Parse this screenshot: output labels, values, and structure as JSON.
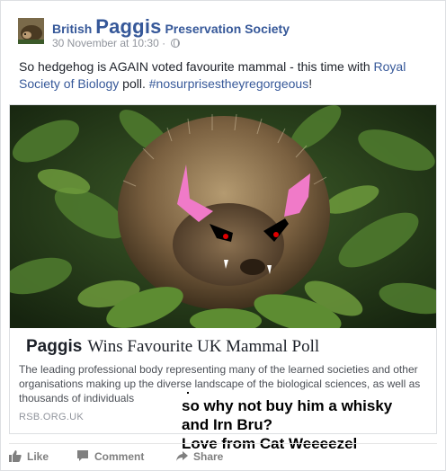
{
  "post": {
    "page_name_prefix": "British",
    "page_name_main": "Paggis",
    "page_name_suffix": "Preservation Society",
    "timestamp": "30 November at 10:30",
    "separator": "·",
    "text_before_link": "So hedgehog is AGAIN voted favourite mammal - this time with ",
    "link_text": "Royal Society of Biology",
    "text_middle": " poll. ",
    "hashtag": "#nosurprisestheyregorgeous",
    "text_end": "!"
  },
  "link_preview": {
    "title_prefix": "Paggis",
    "title": "Wins Favourite UK Mammal Poll",
    "description": "The leading professional body representing many of the learned societies and other organisations making up the diverse landscape of the biological sciences, as well as thousands of individuals",
    "domain": "RSB.ORG.UK"
  },
  "overlay": {
    "line1": "so why not buy him a whisky",
    "line2": "and Irn Bru?",
    "line3": "Love from Cat Weeeezel"
  },
  "actions": {
    "like": "Like",
    "comment": "Comment",
    "share": "Share"
  },
  "icons": {
    "avatar": "hedgehog-avatar",
    "privacy": "globe-icon",
    "like": "thumbs-up-icon",
    "comment": "speech-bubble-icon",
    "share": "share-arrow-icon"
  },
  "colors": {
    "link_blue": "#365899",
    "meta_gray": "#90949c",
    "action_gray": "#7f7f7f",
    "ear_pink": "#f07ac8",
    "eye_red": "#e00000"
  }
}
